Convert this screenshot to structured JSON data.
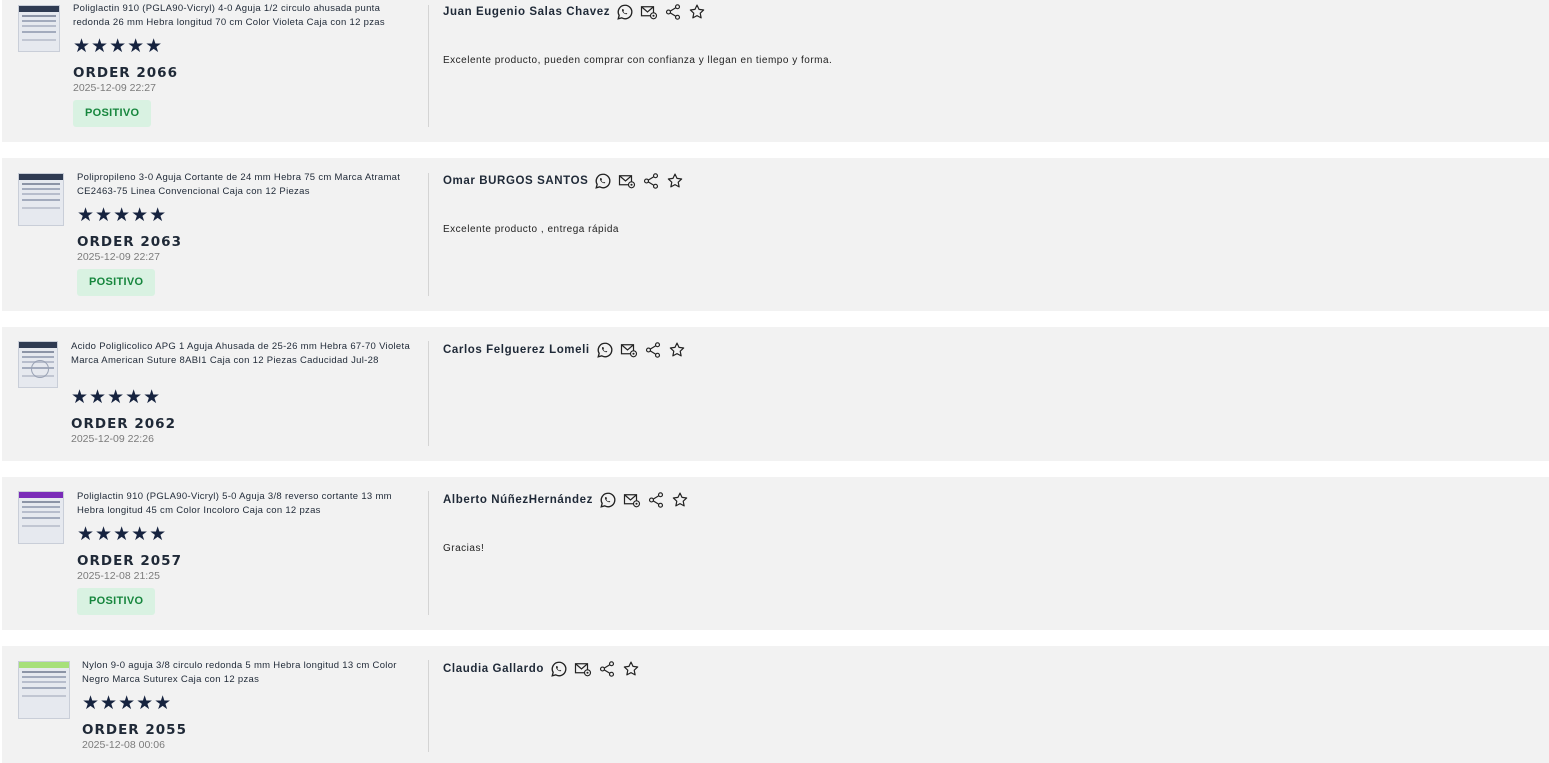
{
  "reviews": [
    {
      "product": "Poliglactin 910 (PGLA90-Vicryl) 4-0 Aguja 1/2 circulo ahusada punta redonda 26 mm Hebra longitud 70 cm Color Violeta Caja con 12 pzas",
      "rating": 5,
      "stars": "★★★★★",
      "order": "ORDER 2066",
      "date": "2025-12-09 22:27",
      "badge": "POSITIVO",
      "customer": "Juan Eugenio Salas Chavez",
      "comment": "Excelente producto, pueden comprar con confianza y llegan en tiempo y forma."
    },
    {
      "product": "Polipropileno 3-0 Aguja Cortante de 24 mm Hebra 75 cm Marca Atramat CE2463-75 Linea Convencional Caja con 12 Piezas",
      "rating": 5,
      "stars": "★★★★★",
      "order": "ORDER 2063",
      "date": "2025-12-09 22:27",
      "badge": "POSITIVO",
      "customer": "Omar BURGOS SANTOS",
      "comment": "Excelente producto , entrega rápida"
    },
    {
      "product": "Acido Poliglicolico APG 1 Aguja Ahusada de 25-26 mm Hebra 67-70 Violeta Marca American Suture 8ABI1 Caja con 12 Piezas Caducidad Jul-28",
      "rating": 5,
      "stars": "★★★★★",
      "order": "ORDER 2062",
      "date": "2025-12-09 22:26",
      "badge": "",
      "customer": "Carlos Felguerez Lomeli",
      "comment": ""
    },
    {
      "product": "Poliglactin 910 (PGLA90-Vicryl) 5-0 Aguja 3/8 reverso cortante 13 mm Hebra longitud 45 cm Color Incoloro Caja con 12 pzas",
      "rating": 5,
      "stars": "★★★★★",
      "order": "ORDER 2057",
      "date": "2025-12-08 21:25",
      "badge": "POSITIVO",
      "customer": "Alberto NúñezHernández",
      "comment": "Gracias!"
    },
    {
      "product": "Nylon 9-0 aguja 3/8 circulo redonda 5 mm Hebra longitud 13 cm Color Negro Marca Suturex Caja con 12 pzas",
      "rating": 5,
      "stars": "★★★★★",
      "order": "ORDER 2055",
      "date": "2025-12-08 00:06",
      "badge": "",
      "customer": "Claudia Gallardo",
      "comment": ""
    }
  ],
  "icons": [
    "whatsapp-icon",
    "email-icon",
    "share-icon",
    "star-outline-icon"
  ],
  "colors": {
    "card_bg": "#f2f2f2",
    "badge_bg": "#d9f2e2",
    "badge_text": "#16863d",
    "stars": "#16233f"
  }
}
